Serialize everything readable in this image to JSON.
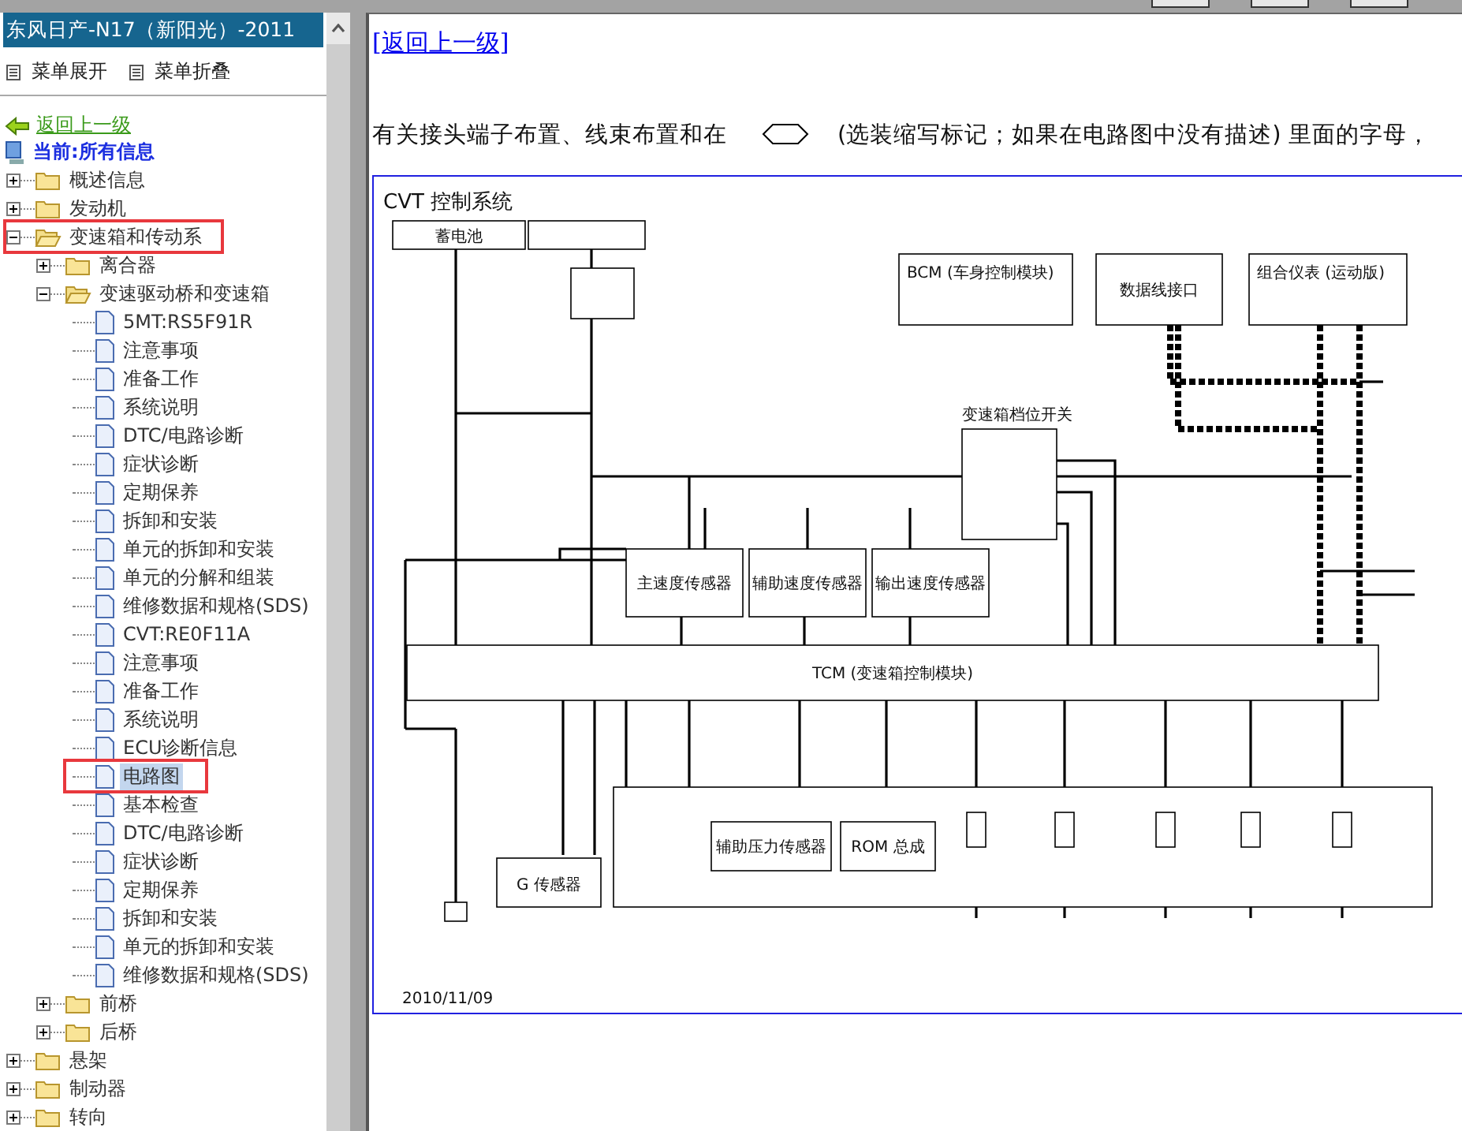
{
  "nav": {
    "title": "东风日产-N17（新阳光）-2011",
    "menu": [
      {
        "label": "菜单展开"
      },
      {
        "label": "菜单折叠"
      }
    ],
    "back_link": "返回上一级",
    "current": "当前:所有信息",
    "tree": [
      {
        "label": "概述信息",
        "kind": "folder",
        "expanded": false,
        "selected": false,
        "highlighted": false
      },
      {
        "label": "发动机",
        "kind": "folder",
        "expanded": false,
        "selected": false,
        "highlighted": false
      },
      {
        "label": "变速箱和传动系",
        "kind": "folder",
        "expanded": true,
        "selected": false,
        "highlighted": true,
        "children": [
          {
            "label": "离合器",
            "kind": "folder",
            "expanded": false,
            "selected": false,
            "highlighted": false
          },
          {
            "label": "变速驱动桥和变速箱",
            "kind": "folder",
            "expanded": true,
            "selected": false,
            "highlighted": false,
            "children": [
              {
                "label": "5MT:RS5F91R",
                "kind": "page",
                "selected": false,
                "highlighted": false
              },
              {
                "label": "注意事项",
                "kind": "page",
                "selected": false,
                "highlighted": false
              },
              {
                "label": "准备工作",
                "kind": "page",
                "selected": false,
                "highlighted": false
              },
              {
                "label": "系统说明",
                "kind": "page",
                "selected": false,
                "highlighted": false
              },
              {
                "label": "DTC/电路诊断",
                "kind": "page",
                "selected": false,
                "highlighted": false
              },
              {
                "label": "症状诊断",
                "kind": "page",
                "selected": false,
                "highlighted": false
              },
              {
                "label": "定期保养",
                "kind": "page",
                "selected": false,
                "highlighted": false
              },
              {
                "label": "拆卸和安装",
                "kind": "page",
                "selected": false,
                "highlighted": false
              },
              {
                "label": "单元的拆卸和安装",
                "kind": "page",
                "selected": false,
                "highlighted": false
              },
              {
                "label": "单元的分解和组装",
                "kind": "page",
                "selected": false,
                "highlighted": false
              },
              {
                "label": "维修数据和规格(SDS)",
                "kind": "page",
                "selected": false,
                "highlighted": false
              },
              {
                "label": "CVT:RE0F11A",
                "kind": "page",
                "selected": false,
                "highlighted": false
              },
              {
                "label": "注意事项",
                "kind": "page",
                "selected": false,
                "highlighted": false
              },
              {
                "label": "准备工作",
                "kind": "page",
                "selected": false,
                "highlighted": false
              },
              {
                "label": "系统说明",
                "kind": "page",
                "selected": false,
                "highlighted": false
              },
              {
                "label": "ECU诊断信息",
                "kind": "page",
                "selected": false,
                "highlighted": false
              },
              {
                "label": "电路图",
                "kind": "page",
                "selected": true,
                "highlighted": true
              },
              {
                "label": "基本检查",
                "kind": "page",
                "selected": false,
                "highlighted": false
              },
              {
                "label": "DTC/电路诊断",
                "kind": "page",
                "selected": false,
                "highlighted": false
              },
              {
                "label": "症状诊断",
                "kind": "page",
                "selected": false,
                "highlighted": false
              },
              {
                "label": "定期保养",
                "kind": "page",
                "selected": false,
                "highlighted": false
              },
              {
                "label": "拆卸和安装",
                "kind": "page",
                "selected": false,
                "highlighted": false
              },
              {
                "label": "单元的拆卸和安装",
                "kind": "page",
                "selected": false,
                "highlighted": false
              },
              {
                "label": "维修数据和规格(SDS)",
                "kind": "page",
                "selected": false,
                "highlighted": false
              }
            ]
          },
          {
            "label": "前桥",
            "kind": "folder",
            "expanded": false,
            "selected": false,
            "highlighted": false
          },
          {
            "label": "后桥",
            "kind": "folder",
            "expanded": false,
            "selected": false,
            "highlighted": false
          }
        ]
      },
      {
        "label": "悬架",
        "kind": "folder",
        "expanded": false,
        "selected": false,
        "highlighted": false
      },
      {
        "label": "制动器",
        "kind": "folder",
        "expanded": false,
        "selected": false,
        "highlighted": false
      },
      {
        "label": "转向",
        "kind": "folder",
        "expanded": false,
        "selected": false,
        "highlighted": false
      }
    ]
  },
  "content": {
    "back_link": "[返回上一级]",
    "note": {
      "before": "有关接头端子布置、线束布置和在",
      "after": "(选装缩写标记；如果在电路图中没有描述) 里面的字母，"
    },
    "diagram": {
      "title": "CVT 控制系统",
      "labels": [
        "蓄电池",
        "BCM (车身控制模块)",
        "数据线接口",
        "组合仪表 (运动版)",
        "变速箱档位开关",
        "主速度传感器",
        "辅助速度传感器",
        "输出速度传感器",
        "TCM (变速箱控制模块)",
        "G 传感器",
        "辅助压力传感器",
        "ROM 总成"
      ],
      "date": "2010/11/09"
    }
  }
}
